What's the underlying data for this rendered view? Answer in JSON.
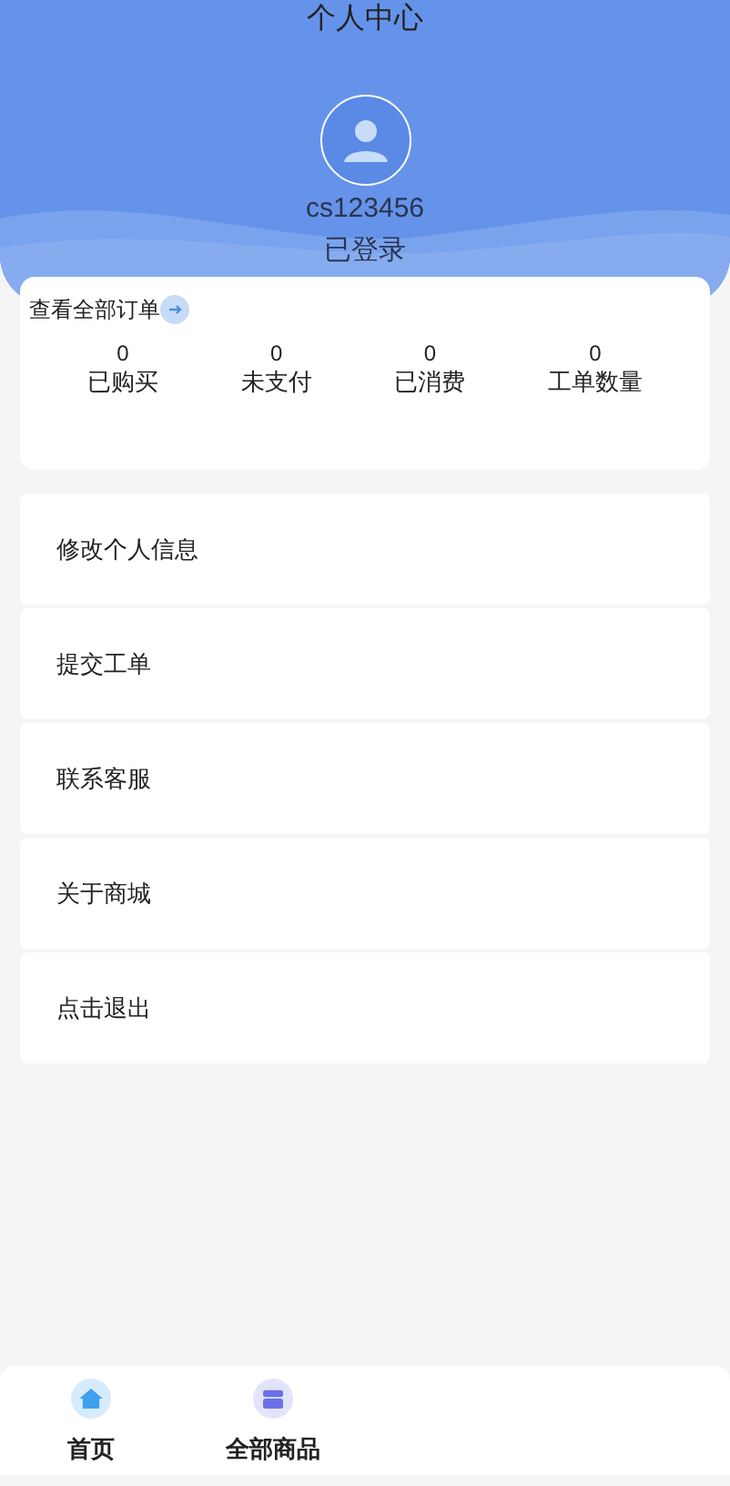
{
  "header": {
    "title": "个人中心",
    "username": "cs123456",
    "status": "已登录"
  },
  "orders": {
    "link": "查看全部订单",
    "stats": [
      {
        "value": "0",
        "label": "已购买"
      },
      {
        "value": "0",
        "label": "未支付"
      },
      {
        "value": "0",
        "label": "已消费"
      },
      {
        "value": "0",
        "label": "工单数量"
      }
    ]
  },
  "menu": [
    "修改个人信息",
    "提交工单",
    "联系客服",
    "关于商城",
    "点击退出"
  ],
  "tab_bar": [
    {
      "label": "首页",
      "kind": "home"
    },
    {
      "label": "全部商品",
      "kind": "store"
    }
  ]
}
